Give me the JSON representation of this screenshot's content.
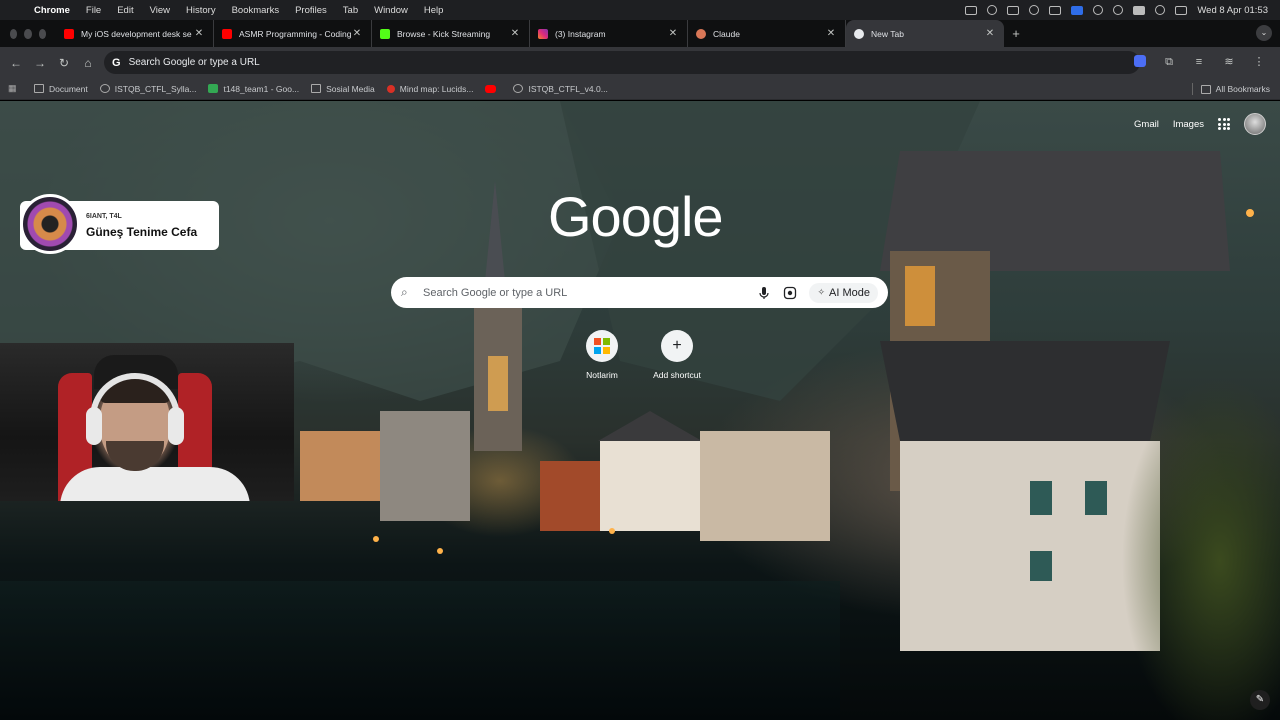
{
  "menubar": {
    "app": "Chrome",
    "items": [
      "File",
      "Edit",
      "View",
      "History",
      "Bookmarks",
      "Profiles",
      "Tab",
      "Window",
      "Help"
    ],
    "clock": "Wed 8 Apr  01:53"
  },
  "tabs": [
    {
      "title": "My iOS development desk se",
      "favicon": "youtube-icon",
      "color": "#ff0000"
    },
    {
      "title": "ASMR Programming - Coding",
      "favicon": "youtube-icon",
      "color": "#ff0000"
    },
    {
      "title": "Browse - Kick Streaming",
      "favicon": "kick-icon",
      "color": "#53fc18"
    },
    {
      "title": "(3) Instagram",
      "favicon": "instagram-icon",
      "color": "#d6249f"
    },
    {
      "title": "Claude",
      "favicon": "claude-icon",
      "color": "#d97757"
    },
    {
      "title": "New Tab",
      "favicon": "chrome-icon",
      "color": "#e8eaed",
      "active": true
    }
  ],
  "toolbar": {
    "omnibox_placeholder": "Search Google or type a URL"
  },
  "bookmarks": {
    "items": [
      {
        "label": "Document",
        "icon": "folder-icon"
      },
      {
        "label": "ISTQB_CTFL_Sylla...",
        "icon": "globe-icon"
      },
      {
        "label": "t148_team1 - Goo...",
        "icon": "sheets-icon"
      },
      {
        "label": "Sosial Media",
        "icon": "folder-icon"
      },
      {
        "label": "Mind map: Lucids...",
        "icon": "lucid-icon"
      },
      {
        "label": "",
        "icon": "youtube-icon"
      },
      {
        "label": "ISTQB_CTFL_v4.0...",
        "icon": "globe-icon"
      }
    ],
    "all_bookmarks": "All Bookmarks"
  },
  "ntp": {
    "gmail": "Gmail",
    "images": "Images",
    "logo": "Google",
    "search_placeholder": "Search Google or type a URL",
    "ai_mode": "AI Mode",
    "shortcuts": [
      {
        "label": "Notlarim",
        "icon": "microsoft-icon"
      },
      {
        "label": "Add shortcut",
        "icon": "plus-icon"
      }
    ]
  },
  "now_playing": {
    "artist": "6IANT, T4L",
    "song": "Güneş Tenime Cefa"
  },
  "colors": {
    "tab_strip": "#0f1011",
    "toolbar": "#35363a",
    "omnibox": "#202124"
  }
}
